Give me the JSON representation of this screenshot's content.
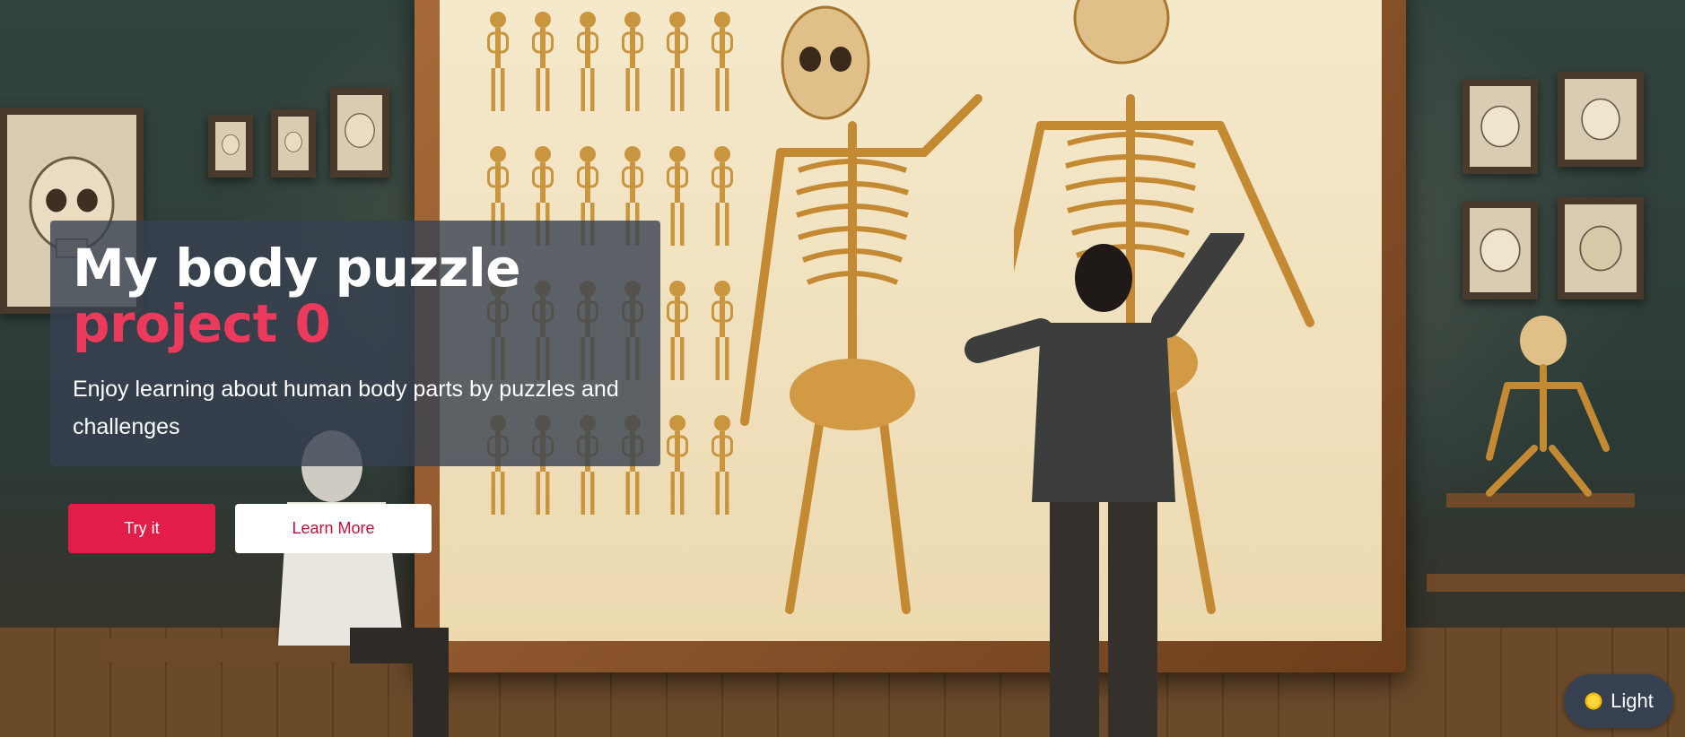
{
  "hero": {
    "title": "My body puzzle",
    "title_accent": "project 0",
    "subtitle": "Enjoy learning about human body parts by puzzles and challenges",
    "primary_button": "Try it",
    "secondary_button": "Learn More"
  },
  "theme_toggle": {
    "label": "Light",
    "icon": "sun-icon"
  },
  "colors": {
    "accent": "#e11d48",
    "accent_text": "#ec3a5c",
    "panel": "#374151"
  },
  "background": {
    "description_icon": "anatomy-classroom-illustration"
  }
}
